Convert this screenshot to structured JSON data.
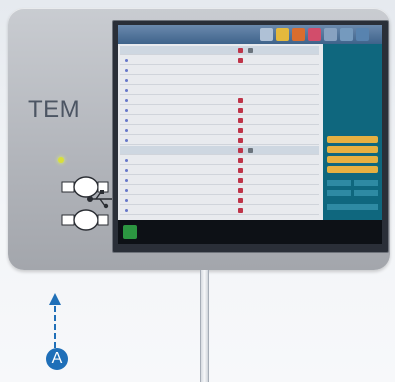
{
  "device": {
    "label": "TEM",
    "marker": "A"
  },
  "icons": {
    "usb": "usb-icon",
    "port_top": "port-connector-icon",
    "port_bottom": "port-connector-icon",
    "indicator_led": "led-icon",
    "up_arrow": "dashed-up-arrow-icon"
  },
  "colors": {
    "accent_blue": "#1f6fb8",
    "screen_teal": "#0e6a82",
    "led_yellow": "#d9df3a",
    "warn_orange": "#f1b742"
  },
  "screen": {
    "title": "",
    "bottom_text": "",
    "bottom_right": ""
  }
}
